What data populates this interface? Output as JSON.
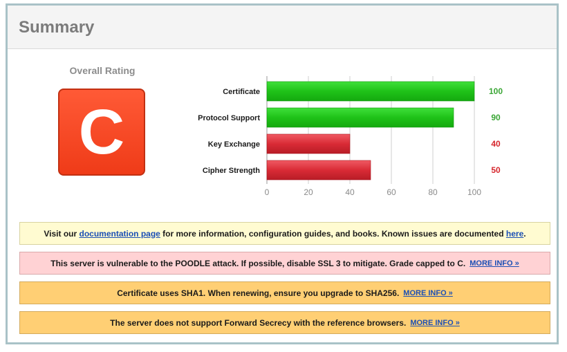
{
  "header": {
    "title": "Summary"
  },
  "rating": {
    "label": "Overall Rating",
    "grade": "C"
  },
  "chart_data": {
    "type": "bar",
    "orientation": "horizontal",
    "categories": [
      "Certificate",
      "Protocol Support",
      "Key Exchange",
      "Cipher Strength"
    ],
    "values": [
      100,
      90,
      40,
      50
    ],
    "value_labels": [
      "100",
      "90",
      "40",
      "50"
    ],
    "bar_colors": [
      "#22c51c",
      "#22c51c",
      "#d92b36",
      "#d92b36"
    ],
    "label_colors": [
      "#3aa635",
      "#3aa635",
      "#d6262c",
      "#d6262c"
    ],
    "xlim": [
      0,
      100
    ],
    "xticks": [
      "0",
      "20",
      "40",
      "60",
      "80",
      "100"
    ],
    "grid": true
  },
  "notices": {
    "info": {
      "t1": "Visit our ",
      "link1": "documentation page",
      "t2": " for more information, configuration guides, and books. Known issues are documented ",
      "link2": "here",
      "t3": "."
    },
    "poodle": {
      "text": "This server is vulnerable to the POODLE attack. If possible, disable SSL 3 to mitigate. Grade capped to C.",
      "more": "MORE INFO »"
    },
    "sha1": {
      "text": "Certificate uses SHA1. When renewing, ensure you upgrade to SHA256.",
      "more": "MORE INFO »"
    },
    "fs": {
      "text": "The server does not support Forward Secrecy with the reference browsers.",
      "more": "MORE INFO »"
    }
  },
  "colors": {
    "grade_bg": "#ef3b18",
    "frame_border": "#a9c2c7"
  }
}
